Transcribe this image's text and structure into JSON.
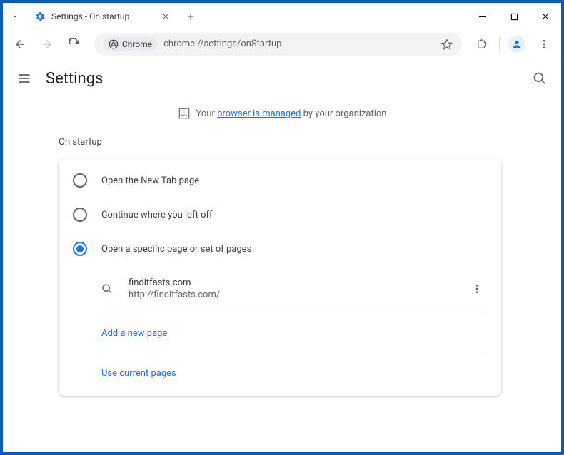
{
  "tab": {
    "title": "Settings - On startup"
  },
  "addressbar": {
    "chip": "Chrome",
    "url": "chrome://settings/onStartup"
  },
  "page": {
    "title": "Settings"
  },
  "managed": {
    "prefix": "Your ",
    "link": "browser is managed",
    "suffix": " by your organization"
  },
  "section": {
    "title": "On startup"
  },
  "radios": [
    {
      "label": "Open the New Tab page",
      "selected": false
    },
    {
      "label": "Continue where you left off",
      "selected": false
    },
    {
      "label": "Open a specific page or set of pages",
      "selected": true
    }
  ],
  "startup_page": {
    "name": "finditfasts.com",
    "url": "http://finditfasts.com/"
  },
  "links": {
    "add": "Add a new page",
    "use_current": "Use current pages"
  }
}
